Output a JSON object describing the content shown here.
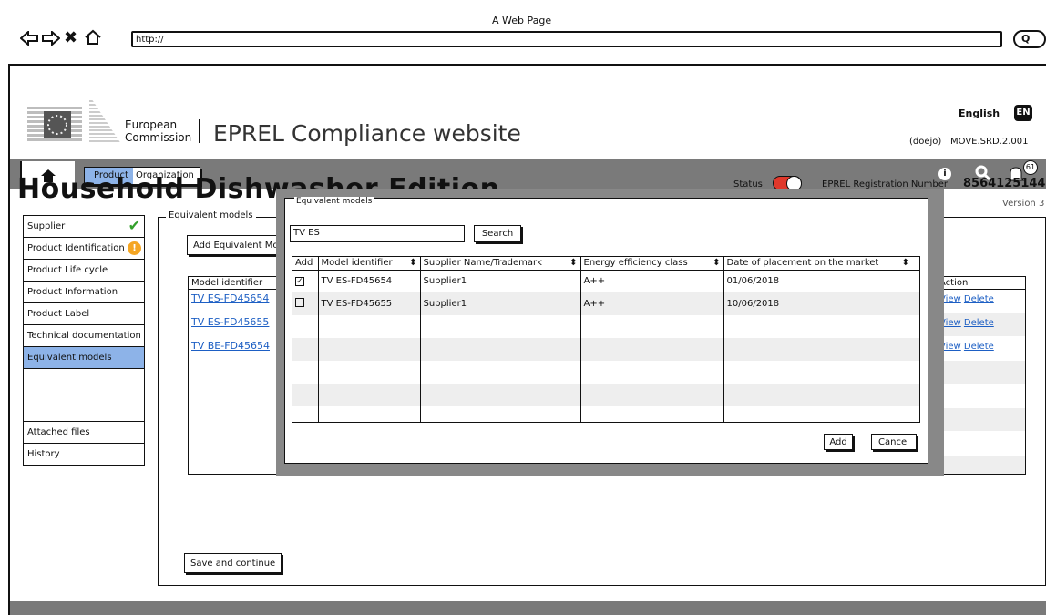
{
  "browser": {
    "window_title": "A Web Page",
    "url": "http://"
  },
  "header": {
    "eu_line1": "European",
    "eu_line2": "Commission",
    "site_title": "EPREL Compliance website",
    "language": "English",
    "language_badge": "EN",
    "user": "(doejo)",
    "org": "MOVE.SRD.2.001"
  },
  "nav": {
    "tabs": [
      {
        "label": "Product"
      },
      {
        "label": "Organization"
      }
    ],
    "notif_count": "61"
  },
  "page": {
    "title": "Household Dishwasher Edition",
    "status_label": "Status",
    "reg_label": "EPREL Registration Number",
    "reg_number": "8564125144",
    "version": "Version 3"
  },
  "sidebar": {
    "items": [
      {
        "label": "Supplier",
        "state": "ok"
      },
      {
        "label": "Product Identification",
        "state": "warn"
      },
      {
        "label": "Product Life cycle"
      },
      {
        "label": "Product Information"
      },
      {
        "label": "Product Label"
      },
      {
        "label": "Technical documentation"
      },
      {
        "label": "Equivalent models",
        "selected": true
      },
      {
        "label": "Attached files"
      },
      {
        "label": "History"
      }
    ]
  },
  "main": {
    "legend": "Equivalent models",
    "add_button": "Add Equivalent Models",
    "col_model": "Model identifier",
    "col_action": "Action",
    "rows": [
      {
        "model": "TV ES-FD45654",
        "view": "View",
        "delete": "Delete"
      },
      {
        "model": "TV ES-FD45655",
        "view": "View",
        "delete": "Delete"
      },
      {
        "model": "TV BE-FD45654",
        "view": "View",
        "delete": "Delete"
      }
    ],
    "save_button": "Save and continue"
  },
  "modal": {
    "legend": "Equivalent models",
    "search_value": "TV ES",
    "search_button": "Search",
    "columns": [
      "Add",
      "Model identifier",
      "Supplier Name/Trademark",
      "Energy efficiency class",
      "Date of placement on the market"
    ],
    "rows": [
      {
        "checked": true,
        "model": "TV ES-FD45654",
        "supplier": "Supplier1",
        "energy": "A++",
        "date": "01/06/2018"
      },
      {
        "checked": false,
        "model": "TV ES-FD45655",
        "supplier": "Supplier1",
        "energy": "A++",
        "date": "10/06/2018"
      }
    ],
    "add_button": "Add",
    "cancel_button": "Cancel"
  },
  "colors": {
    "chrome_gray": "#7a7a7a",
    "selection_blue": "#8db3e8",
    "toggle_red": "#e0382b",
    "ok_green": "#33a02c",
    "warn_orange": "#f5a623",
    "link_blue": "#1d5fc4"
  }
}
